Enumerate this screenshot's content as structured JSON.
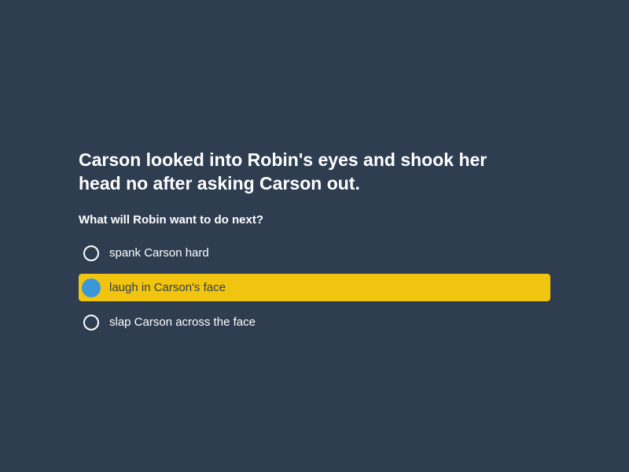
{
  "scenario": "Carson looked into Robin's eyes and shook her head no after asking Carson out.",
  "question": "What will Robin want to do next?",
  "options": [
    {
      "label": "spank Carson hard",
      "selected": false
    },
    {
      "label": "laugh in Carson's face",
      "selected": true
    },
    {
      "label": "slap Carson across the face",
      "selected": false
    }
  ],
  "colors": {
    "background": "#2e3e50",
    "selected_highlight": "#f1c40f",
    "selected_radio": "#3a98d8",
    "text": "#ffffff"
  }
}
